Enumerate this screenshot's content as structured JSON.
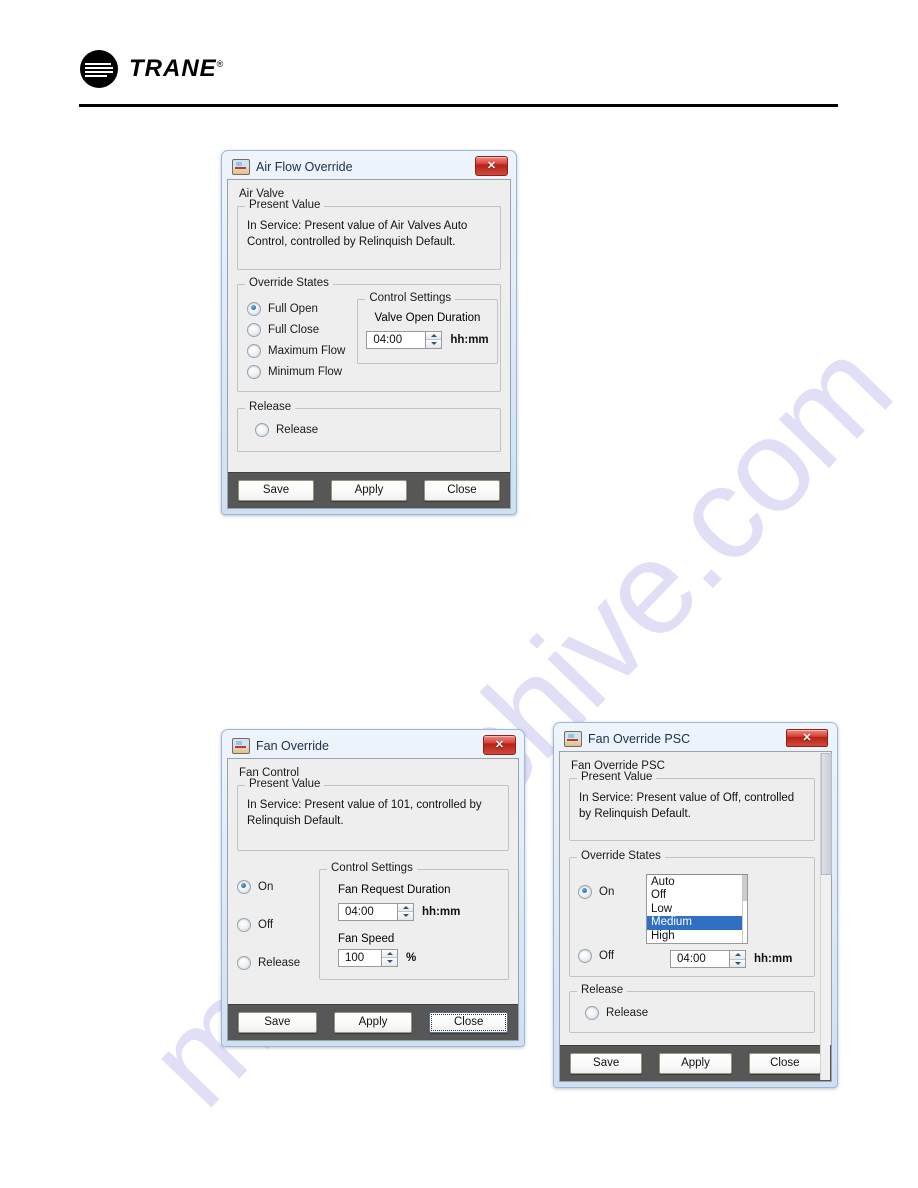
{
  "page": {
    "brand": "TRANE",
    "brand_tm": "®",
    "watermark": "manualshive.com"
  },
  "dialogs": [
    {
      "id": "air-flow-override",
      "title": "Air Flow Override",
      "close_label": "✕",
      "section_label": "Air Valve",
      "present_value": {
        "legend": "Present Value",
        "text": "In Service: Present value of Air Valves Auto Control, controlled by Relinquish Default."
      },
      "override_states": {
        "legend": "Override States",
        "options": [
          {
            "label": "Full Open",
            "selected": true
          },
          {
            "label": "Full Close",
            "selected": false
          },
          {
            "label": "Maximum Flow",
            "selected": false
          },
          {
            "label": "Minimum Flow",
            "selected": false
          }
        ]
      },
      "control_settings": {
        "legend": "Control Settings",
        "duration_label": "Valve Open Duration",
        "duration_value": "04:00",
        "duration_unit": "hh:mm"
      },
      "release": {
        "legend": "Release",
        "option_label": "Release",
        "selected": false
      },
      "buttons": [
        {
          "label": "Save",
          "focused": false
        },
        {
          "label": "Apply",
          "focused": false
        },
        {
          "label": "Close",
          "focused": false
        }
      ]
    },
    {
      "id": "fan-override",
      "title": "Fan Override",
      "close_label": "✕",
      "section_label": "Fan Control",
      "present_value": {
        "legend": "Present Value",
        "text": "In Service: Present value of 101, controlled by Relinquish Default."
      },
      "override_states": {
        "options": [
          {
            "label": "On",
            "selected": true
          },
          {
            "label": "Off",
            "selected": false
          },
          {
            "label": "Release",
            "selected": false
          }
        ]
      },
      "control_settings": {
        "legend": "Control Settings",
        "duration_label": "Fan Request Duration",
        "duration_value": "04:00",
        "duration_unit": "hh:mm",
        "speed_label": "Fan Speed",
        "speed_value": "100",
        "speed_unit": "%"
      },
      "buttons": [
        {
          "label": "Save",
          "focused": false
        },
        {
          "label": "Apply",
          "focused": false
        },
        {
          "label": "Close",
          "focused": true
        }
      ]
    },
    {
      "id": "fan-override-psc",
      "title": "Fan Override PSC",
      "close_label": "✕",
      "section_label": "Fan Override PSC",
      "present_value": {
        "legend": "Present Value",
        "text": "In Service: Present value of Off, controlled by Relinquish Default."
      },
      "override_states": {
        "legend": "Override States",
        "options": [
          {
            "label": "On",
            "selected": true
          },
          {
            "label": "Off",
            "selected": false
          }
        ],
        "speed_list": [
          {
            "label": "Auto",
            "selected": false
          },
          {
            "label": "Off",
            "selected": false
          },
          {
            "label": "Low",
            "selected": false
          },
          {
            "label": "Medium",
            "selected": true
          },
          {
            "label": "High",
            "selected": false
          }
        ],
        "duration_value": "04:00",
        "duration_unit": "hh:mm"
      },
      "release": {
        "legend": "Release",
        "option_label": "Release",
        "selected": false
      },
      "buttons": [
        {
          "label": "Save",
          "focused": false
        },
        {
          "label": "Apply",
          "focused": false
        },
        {
          "label": "Close",
          "focused": false
        }
      ]
    }
  ]
}
